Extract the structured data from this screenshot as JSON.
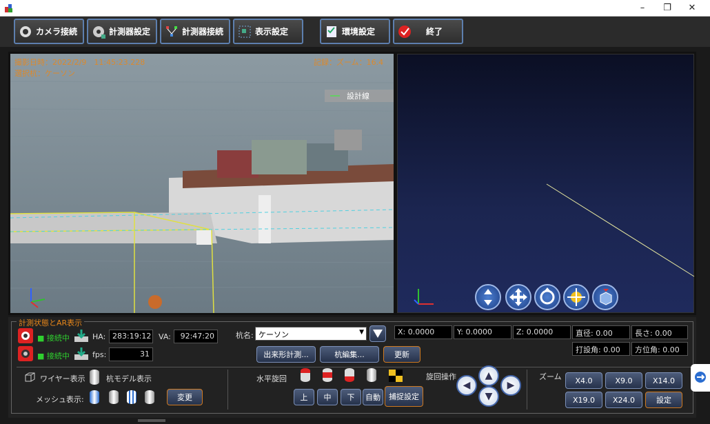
{
  "window": {
    "min": "–",
    "max": "❐",
    "close": "✕"
  },
  "toolbar": {
    "camera_connect": "カメラ接続",
    "instrument_settings": "計測器設定",
    "instrument_connect": "計測器接続",
    "display_settings": "表示設定",
    "environment_settings": "環境設定",
    "exit": "終了"
  },
  "camera": {
    "datetime": "撮影日時：2022/2/9　11:45:23.228",
    "selected": "選択杭：ケーソン",
    "status": "記録：ズーム：16.4",
    "legend": "設計線"
  },
  "bottom": {
    "group_title": "計測状態とAR表示",
    "status1": "■ 接続中",
    "status2": "■ 接続中",
    "ha_label": "HA:",
    "ha_value": "283:19:12",
    "va_label": "VA:",
    "va_value": "92:47:20",
    "fps_label": "fps:",
    "fps_value": "31",
    "pile_name_label": "杭名:",
    "pile_name_value": "ケーソン",
    "btn_measure": "出来形計測...",
    "btn_edit": "杭編集...",
    "btn_update": "更新",
    "x": "X: 0.0000",
    "y": "Y: 0.0000",
    "z": "Z: 0.0000",
    "diameter": "直径: 0.00",
    "length": "長さ: 0.00",
    "drive_angle": "打設角: 0.00",
    "azimuth": "方位角: 0.00",
    "wire_label": "ワイヤー表示",
    "model_label": "杭モデル表示",
    "mesh_label": "メッシュ表示:",
    "btn_change": "変更",
    "rotate_label": "水平旋回",
    "btn_up": "上",
    "btn_mid": "中",
    "btn_down": "下",
    "btn_auto": "自動",
    "btn_track": "捕捉設定",
    "rotate_op_label": "旋回操作",
    "zoom_label": "ズーム",
    "zoom": [
      "X4.0",
      "X9.0",
      "X14.0",
      "X19.0",
      "X24.0"
    ],
    "btn_settings": "設定"
  },
  "colors": {
    "accent": "#e8871a",
    "status_green": "#2fcf2f",
    "button_border": "#7c90b8"
  }
}
